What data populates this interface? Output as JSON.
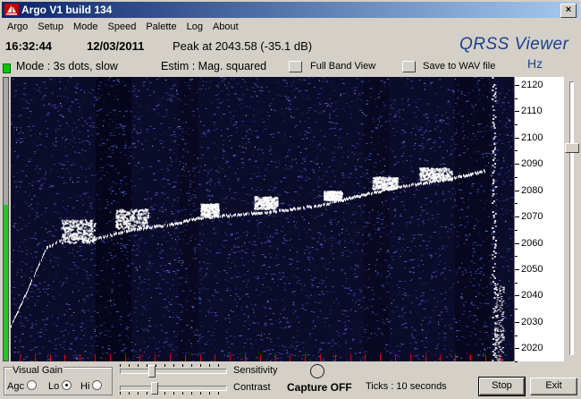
{
  "window": {
    "title": "Argo V1 build 134",
    "close_glyph": "×"
  },
  "menu": [
    "Argo",
    "Setup",
    "Mode",
    "Speed",
    "Palette",
    "Log",
    "About"
  ],
  "status": {
    "clock": "16:32:44",
    "date": "12/03/2011",
    "peak": "Peak at 2043.58 (-35.1 dB)",
    "brand": "QRSS Viewer",
    "unit": "Hz",
    "mode": "Mode : 3s dots, slow",
    "estim": "Estim : Mag. squared",
    "full_band_label": "Full Band View",
    "save_wav_label": "Save to WAV file"
  },
  "freq_scale": {
    "min": 2015,
    "max": 2123,
    "labels": [
      "2120",
      "2110",
      "2100",
      "2090",
      "2080",
      "2070",
      "2060",
      "2050",
      "2040",
      "2030",
      "2020"
    ],
    "values": [
      2120,
      2110,
      2100,
      2090,
      2080,
      2070,
      2060,
      2050,
      2040,
      2030,
      2020
    ]
  },
  "level_meter": {
    "fraction": 0.55,
    "color": "#20c820"
  },
  "waterfall": {
    "background": "#0b0b2a",
    "noise_color": "#4a5fd0",
    "signal_color": "#ffffff"
  },
  "controls": {
    "visual_gain": "Visual Gain",
    "agc": "Agc",
    "lo": "Lo",
    "hi": "Hi",
    "selected": "Lo",
    "sensitivity": "Sensitivity",
    "contrast": "Contrast",
    "capture": "Capture OFF",
    "ticks": "Ticks  : 10 seconds",
    "stop": "Stop",
    "exit": "Exit"
  }
}
